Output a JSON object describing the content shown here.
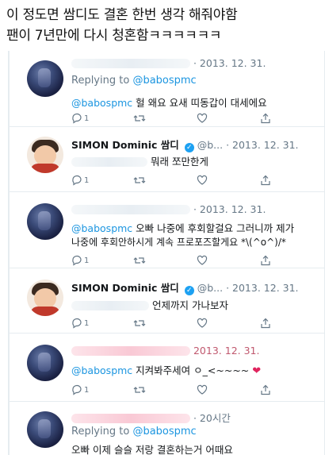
{
  "caption": {
    "line1": "이 정도면 쌈디도 결혼 한번 생각 해줘야함",
    "line2": "팬이 7년만에 다시 청혼함ㅋㅋㅋㅋㅋㅋ"
  },
  "tweets": [
    {
      "author_type": "fan",
      "date": "· 2013. 12. 31.",
      "replying_label": "Replying to",
      "replying_to": "@babospmc",
      "mention": "@babospmc",
      "text": "헐 왜요 요새 띠동갑이 대세에요",
      "reply_count": "1",
      "like_count": ""
    },
    {
      "author_type": "simon",
      "name": "SIMON Dominic 쌈디",
      "handle": "@b...",
      "date": "· 2013. 12. 31.",
      "text": "뭐래 쪼만한게",
      "reply_count": "1",
      "like_count": ""
    },
    {
      "author_type": "fan",
      "date": "· 2013. 12. 31.",
      "mention": "@babospmc",
      "text_line1": "오빠 나중에 후회할걸요 그러니까 제가",
      "text_line2": "나중에 후회안하시게 계속 프로포즈할게요 *\\(^o^)/*",
      "reply_count": "1",
      "like_count": ""
    },
    {
      "author_type": "simon",
      "name": "SIMON Dominic 쌈디",
      "handle": "@b...",
      "date": "· 2013. 12. 31.",
      "text": "언제까지 가나보자",
      "reply_count": "1",
      "like_count": ""
    },
    {
      "author_type": "fan",
      "date": "2013. 12. 31.",
      "mention": "@babospmc",
      "text": "지켜봐주세여 ㅇ_<~~~~",
      "reply_count": "1",
      "like_count": ""
    },
    {
      "author_type": "fan",
      "date": "· 20시간",
      "replying_label": "Replying to",
      "replying_to": "@babospmc",
      "text": "오빠 이제 슬슬 저랑 결혼하는거 어때요"
    }
  ],
  "colors": {
    "link": "#1b95e0",
    "meta": "#657786",
    "verified": "#1da1f2",
    "heart": "#e0245e",
    "border": "#e6ecf0"
  },
  "icons": [
    "reply-icon",
    "retweet-icon",
    "like-icon",
    "share-icon",
    "verified-badge-icon",
    "heart-emoji-icon"
  ]
}
